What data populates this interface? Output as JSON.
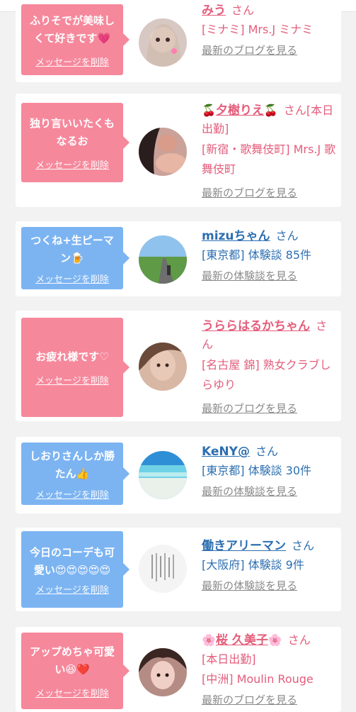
{
  "top_fragment": "…|…|…",
  "san": "さん",
  "cards": [
    {
      "message": "ふりそでが美味しくて好きです",
      "message_emoji": "💗",
      "delete_label": "メッセージを削除",
      "name": "みう",
      "name_suffix": "",
      "meta": "[ミナミ] Mrs.J ミナミ",
      "link": "最新のブログを見る"
    },
    {
      "message": "独り言いいたくもなるお",
      "delete_label": "メッセージを削除",
      "name_prefix_emoji": "🍒",
      "name": "夕樹りえ",
      "name_suffix_emoji": "🍒",
      "san_extra": "[本日出勤]",
      "meta": "[新宿・歌舞伎町] Mrs.J 歌舞伎町",
      "link": "最新のブログを見る"
    },
    {
      "message": "つくね+生ピーマン",
      "message_emoji": "🍺",
      "delete_label": "メッセージを削除",
      "name": "mizuちゃん",
      "meta": "[東京都] 体験談 85件",
      "link": "最新の体験談を見る"
    },
    {
      "message": "お疲れ様です♡",
      "delete_label": "メッセージを削除",
      "name": "うららはるかちゃん",
      "meta": "[名古屋 錦] 熟女クラブしらゆり",
      "link": "最新のブログを見る"
    },
    {
      "message": "しおりさんしか勝たん",
      "message_emoji": "👍",
      "delete_label": "メッセージを削除",
      "name": "KeNY@",
      "meta": "[東京都] 体験談 30件",
      "link": "最新の体験談を見る"
    },
    {
      "message": "今日のコーデも可愛い",
      "message_emoji": "😍😍😍😍😍",
      "delete_label": "メッセージを削除",
      "name": "働きアリーマン",
      "meta": "[大阪府] 体験談 9件",
      "link": "最新の体験談を見る"
    },
    {
      "message": "アップめちゃ可愛い",
      "message_emoji": "😆❤️",
      "delete_label": "メッセージを削除",
      "name_prefix_emoji": "🌸",
      "name": "桜 久美子",
      "name_suffix_emoji": "🌸",
      "meta_1": "[本日出勤]",
      "meta_2": "[中洲] Moulin Rouge",
      "link": "最新のブログを見る"
    }
  ],
  "colors": {
    "pink_bubble": "#f6889c",
    "blue_bubble": "#7cb4f2",
    "pink_text": "#e45d7b",
    "blue_text": "#2d6fb0",
    "link_gray": "#8a8a8a",
    "background": "#f2f2f2"
  }
}
